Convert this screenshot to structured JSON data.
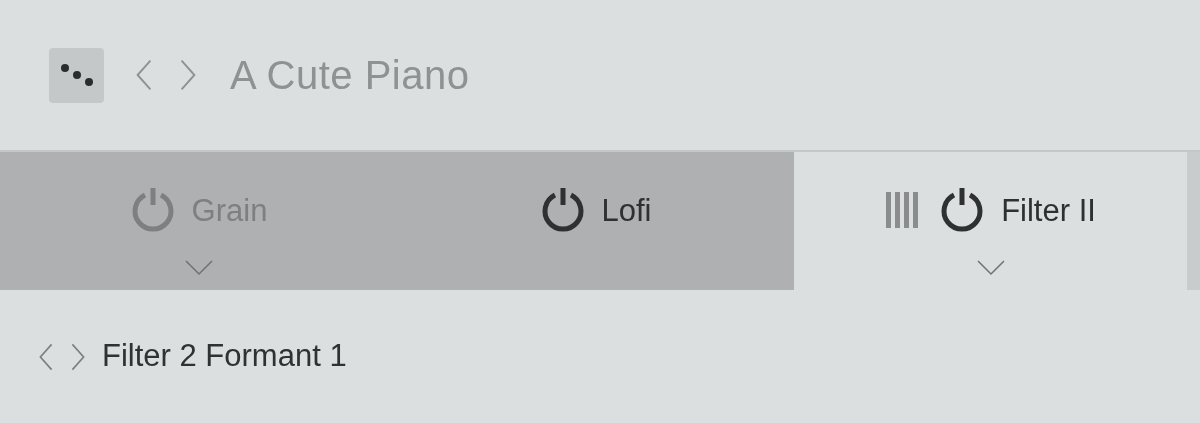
{
  "header": {
    "title": "A Cute Piano"
  },
  "tabs": [
    {
      "label": "Grain",
      "on": false,
      "selected": false,
      "dropdown": true,
      "handle": false
    },
    {
      "label": "Lofi",
      "on": true,
      "selected": false,
      "dropdown": false,
      "handle": false
    },
    {
      "label": "Filter II",
      "on": true,
      "selected": true,
      "dropdown": true,
      "handle": true
    }
  ],
  "preset": {
    "name": "Filter 2 Formant 1"
  }
}
